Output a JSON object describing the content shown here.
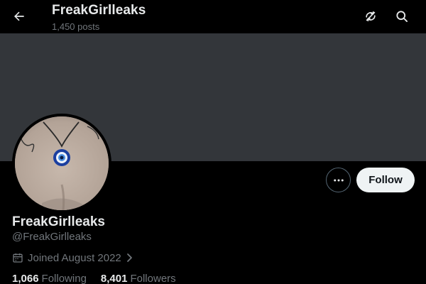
{
  "header": {
    "title": "FreakGirlleaks",
    "post_count": "1,450 posts"
  },
  "profile": {
    "display_name": "FreakGirlleaks",
    "handle": "@FreakGirlleaks",
    "joined": "Joined August 2022",
    "following_count": "1,066",
    "following_label": "Following",
    "followers_count": "8,401",
    "followers_label": "Followers"
  },
  "actions": {
    "follow_label": "Follow"
  },
  "icons": {
    "back": "arrow-left-icon",
    "refresh": "refresh-icon",
    "search": "search-icon",
    "more": "more-icon",
    "calendar": "calendar-icon",
    "chevron": "chevron-right-icon"
  },
  "colors": {
    "background": "#000000",
    "banner": "#33363a",
    "text_primary": "#e7e9ea",
    "text_secondary": "#71767b",
    "follow_button_bg": "#eff3f4",
    "follow_button_text": "#0f1419",
    "border": "#536471"
  }
}
